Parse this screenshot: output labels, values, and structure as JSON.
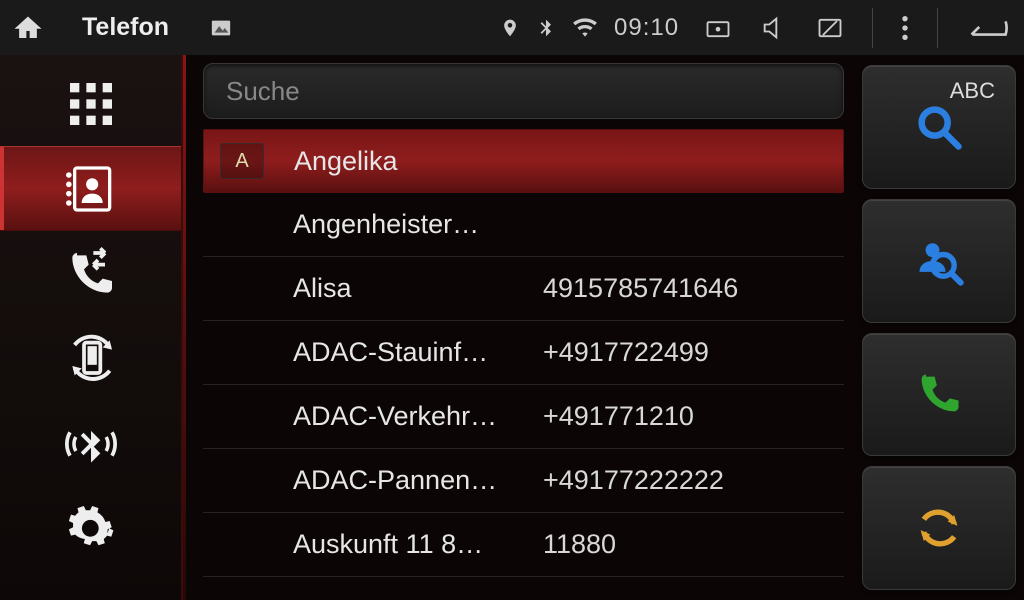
{
  "status": {
    "title": "Telefon",
    "clock": "09:10"
  },
  "search": {
    "placeholder": "Suche"
  },
  "contacts": [
    {
      "section": "A",
      "name": "Angelika",
      "number": "",
      "selected": true
    },
    {
      "section": "",
      "name": "Angenheister…",
      "number": ""
    },
    {
      "section": "",
      "name": "Alisa",
      "number": "4915785741646"
    },
    {
      "section": "",
      "name": "ADAC-Stauinf…",
      "number": "+4917722499"
    },
    {
      "section": "",
      "name": "ADAC-Verkehr…",
      "number": "+491771210"
    },
    {
      "section": "",
      "name": "ADAC-Pannen…",
      "number": "+49177222222"
    },
    {
      "section": "",
      "name": "Auskunft 11 8…",
      "number": "11880"
    }
  ],
  "action_abc": "ABC"
}
